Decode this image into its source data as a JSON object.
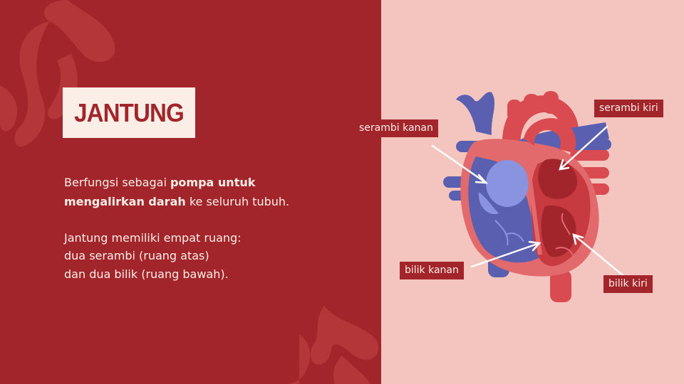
{
  "title": "JANTUNG",
  "description": {
    "line1_a": "Berfungsi sebagai ",
    "line1_b": "pompa untuk",
    "line2_a": "mengalirkan darah",
    "line2_b": " ke seluruh tubuh.",
    "line3": "Jantung memiliki empat ruang:",
    "line4": "dua serambi (ruang atas)",
    "line5": "dan dua bilik (ruang bawah)."
  },
  "labels": {
    "serambi_kanan": "serambi kanan",
    "serambi_kiri": "serambi kiri",
    "bilik_kanan": "bilik kanan",
    "bilik_kiri": "bilik kiri"
  },
  "colors": {
    "background_left": "#a1252b",
    "background_right": "#f4c5bf",
    "title_box": "#fbeee6",
    "heart_red": "#d94b50",
    "heart_blue": "#5b5fb0",
    "heart_light_blue": "#8a93e0"
  }
}
